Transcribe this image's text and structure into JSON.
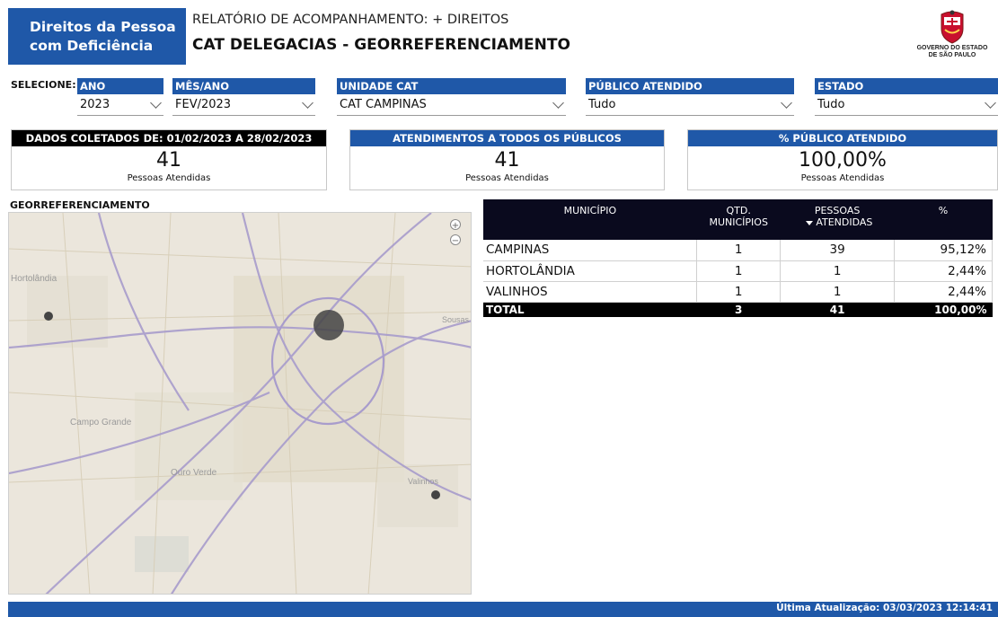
{
  "header": {
    "brand_line1": "Direitos da Pessoa",
    "brand_line2": "com Deficiência",
    "report_subtitle": "RELATÓRIO DE ACOMPANHAMENTO: + DIREITOS",
    "report_title": "CAT DELEGACIAS - GEORREFERENCIAMENTO",
    "gov_logo_line1": "GOVERNO DO ESTADO",
    "gov_logo_line2": "DE SÃO PAULO"
  },
  "filters": {
    "label": "SELECIONE:",
    "items": [
      {
        "title": "ANO",
        "value": "2023"
      },
      {
        "title": "MÊS/ANO",
        "value": "FEV/2023"
      },
      {
        "title": "UNIDADE CAT",
        "value": "CAT CAMPINAS"
      },
      {
        "title": "PÚBLICO ATENDIDO",
        "value": "Tudo"
      },
      {
        "title": "ESTADO",
        "value": "Tudo"
      }
    ]
  },
  "kpis": [
    {
      "title": "DADOS COLETADOS DE: 01/02/2023 A 28/02/2023",
      "value": "41",
      "label": "Pessoas Atendidas",
      "head_color": "#000000"
    },
    {
      "title": "ATENDIMENTOS A TODOS OS PÚBLICOS",
      "value": "41",
      "label": "Pessoas Atendidas",
      "head_color": "#1f58a8"
    },
    {
      "title": "% PÚBLICO ATENDIDO",
      "value": "100,00%",
      "label": "Pessoas Atendidas",
      "head_color": "#1f58a8"
    }
  ],
  "map": {
    "title": "GEORREFERENCIAMENTO",
    "place_labels": [
      "Hortolândia",
      "Campo Grande",
      "Ouro Verde",
      "Valinhos",
      "Sousas"
    ],
    "zoom_in": "+",
    "zoom_out": "−"
  },
  "table": {
    "headers": {
      "municipio": "MUNICÍPIO",
      "qtd_line1": "QTD.",
      "qtd_line2": "MUNICÍPIOS",
      "pessoas_line1": "PESSOAS",
      "pessoas_line2": "ATENDIDAS",
      "pct": "%"
    },
    "rows": [
      {
        "municipio": "CAMPINAS",
        "qtd": "1",
        "pessoas": "39",
        "pct": "95,12%"
      },
      {
        "municipio": "HORTOLÂNDIA",
        "qtd": "1",
        "pessoas": "1",
        "pct": "2,44%"
      },
      {
        "municipio": "VALINHOS",
        "qtd": "1",
        "pessoas": "1",
        "pct": "2,44%"
      }
    ],
    "total": {
      "label": "TOTAL",
      "qtd": "3",
      "pessoas": "41",
      "pct": "100,00%"
    }
  },
  "footer": {
    "last_update": "Última Atualização: 03/03/2023 12:14:41"
  },
  "colors": {
    "brand_blue": "#1f58a8",
    "table_header": "#0a0a1e",
    "map_bubble": "#444444"
  }
}
